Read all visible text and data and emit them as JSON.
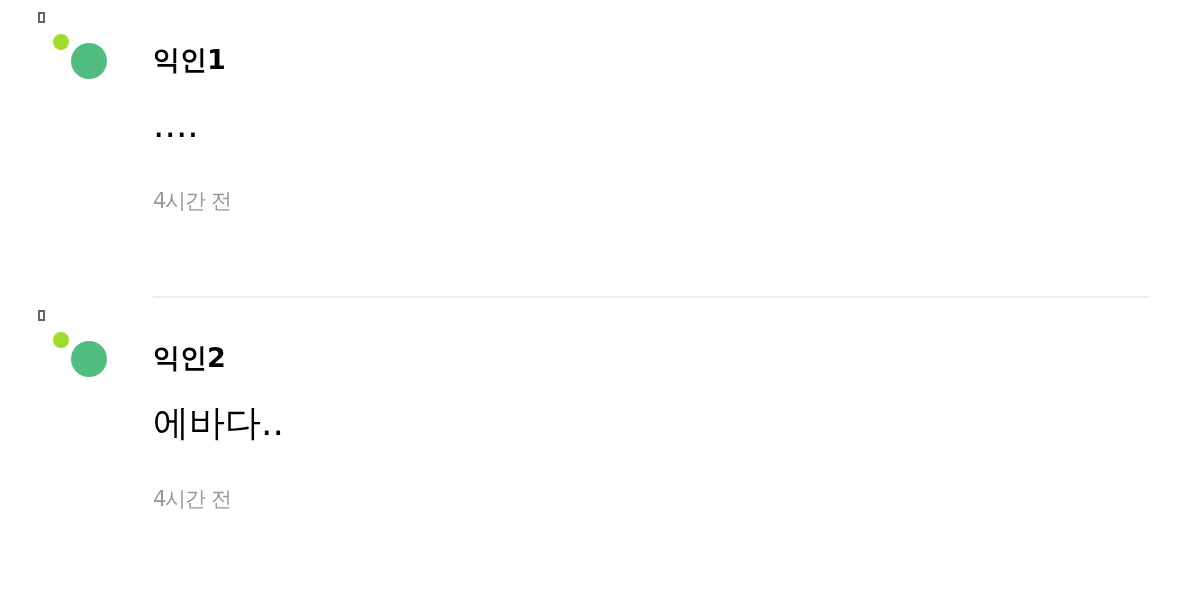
{
  "comments": [
    {
      "author": "익인1",
      "text": "....",
      "time": "4시간 전"
    },
    {
      "author": "익인2",
      "text": "에바다..",
      "time": "4시간 전"
    }
  ]
}
